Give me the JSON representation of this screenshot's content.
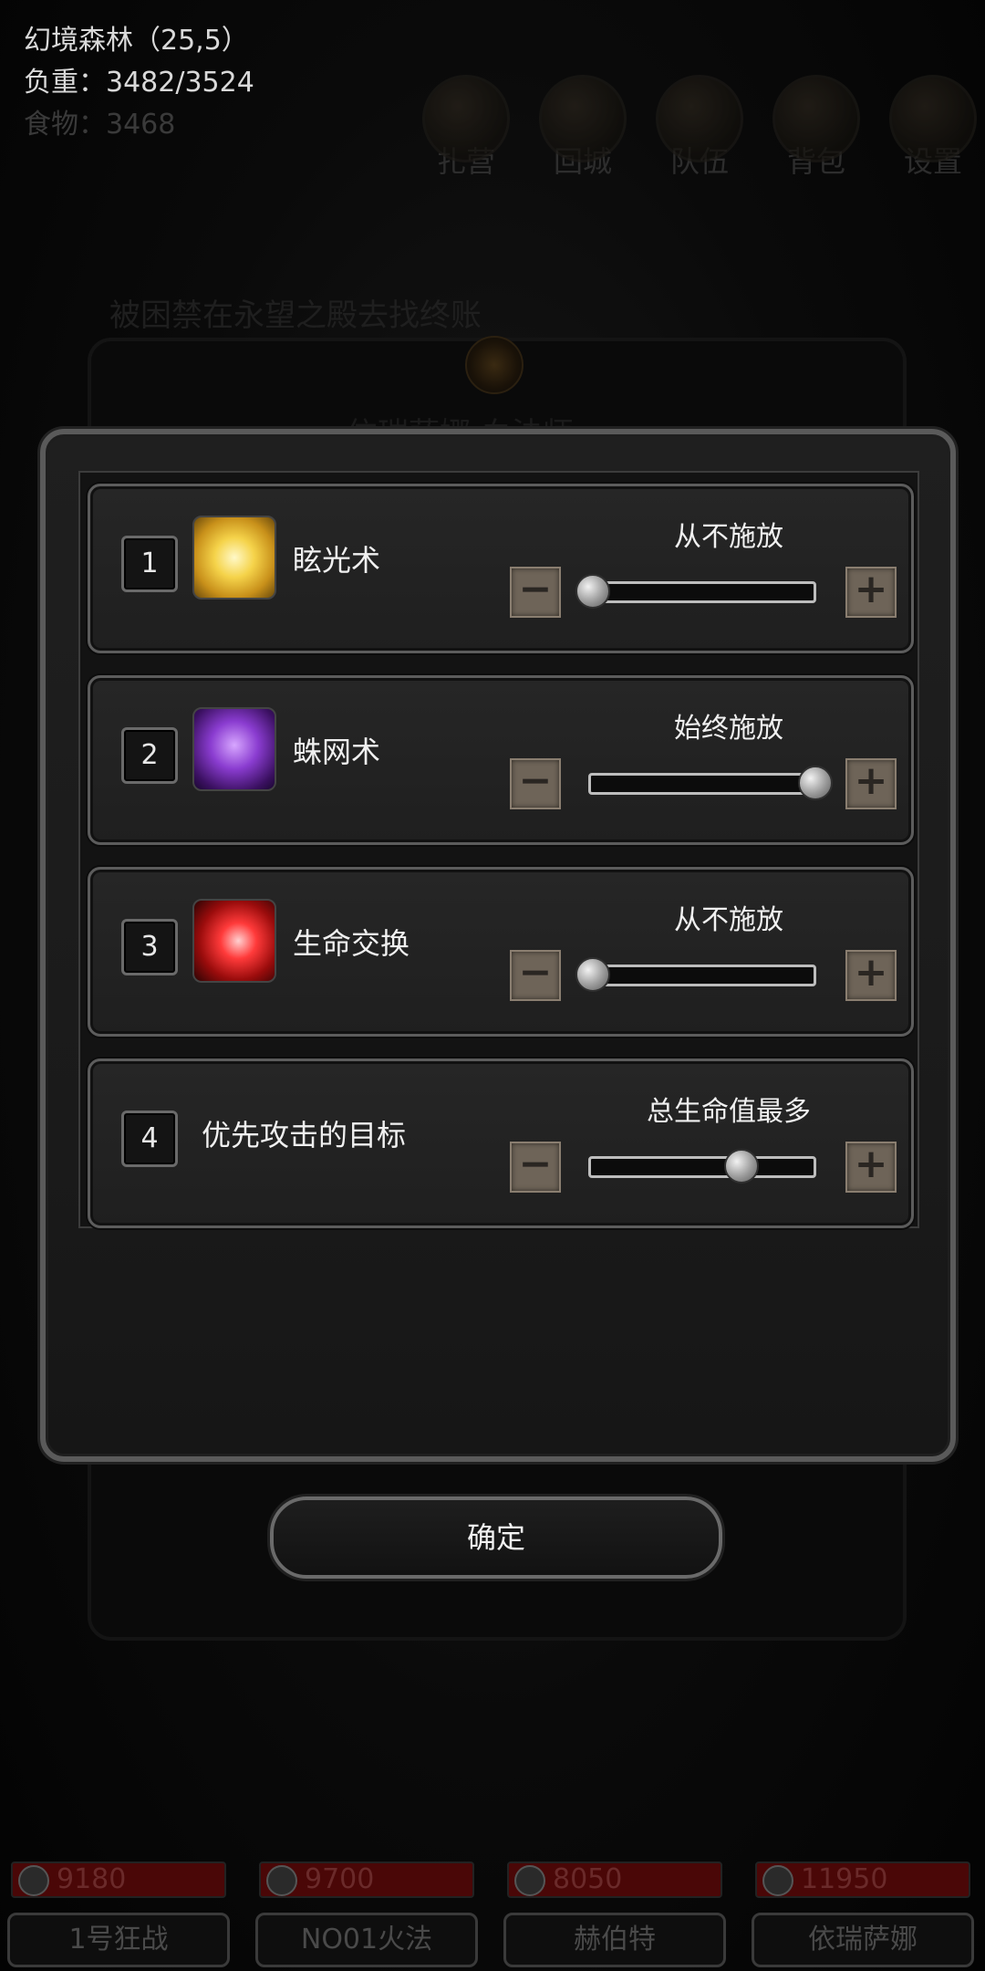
{
  "status": {
    "location": "幻境森林（25,5）",
    "weight": "负重：3482/3524",
    "food": "食物：3468"
  },
  "top_menu": [
    {
      "label": "扎营",
      "icon": "tent-icon"
    },
    {
      "label": "回城",
      "icon": "portal-icon"
    },
    {
      "label": "队伍",
      "icon": "team-icon"
    },
    {
      "label": "背包",
      "icon": "bag-icon"
    },
    {
      "label": "设置",
      "icon": "gear-icon"
    }
  ],
  "underlay": {
    "message": "被困禁在永望之殿去找终账",
    "character_title": "依瑞萨娜 血法师"
  },
  "skills": [
    {
      "index": "1",
      "name": "眩光术",
      "icon": "dazzle-icon",
      "mode": "从不施放",
      "level": 0.0
    },
    {
      "index": "2",
      "name": "蛛网术",
      "icon": "spiderweb-icon",
      "mode": "始终施放",
      "level": 1.0
    },
    {
      "index": "3",
      "name": "生命交换",
      "icon": "life-swap-icon",
      "mode": "从不施放",
      "level": 0.0
    },
    {
      "index": "4",
      "name": "优先攻击的目标",
      "icon": "",
      "mode": "总生命值最多",
      "level": 0.67
    }
  ],
  "controls": {
    "minus": "−",
    "plus": "+"
  },
  "confirm_label": "确定",
  "party": [
    {
      "hp": "9180",
      "name": "1号狂战"
    },
    {
      "hp": "9700",
      "name": "NO01火法"
    },
    {
      "hp": "8050",
      "name": "赫伯特"
    },
    {
      "hp": "11950",
      "name": "依瑞萨娜"
    }
  ],
  "colors": {
    "hp_bar": "#4a0707",
    "button": "#6e6458",
    "frame": "#5a5a5a"
  }
}
